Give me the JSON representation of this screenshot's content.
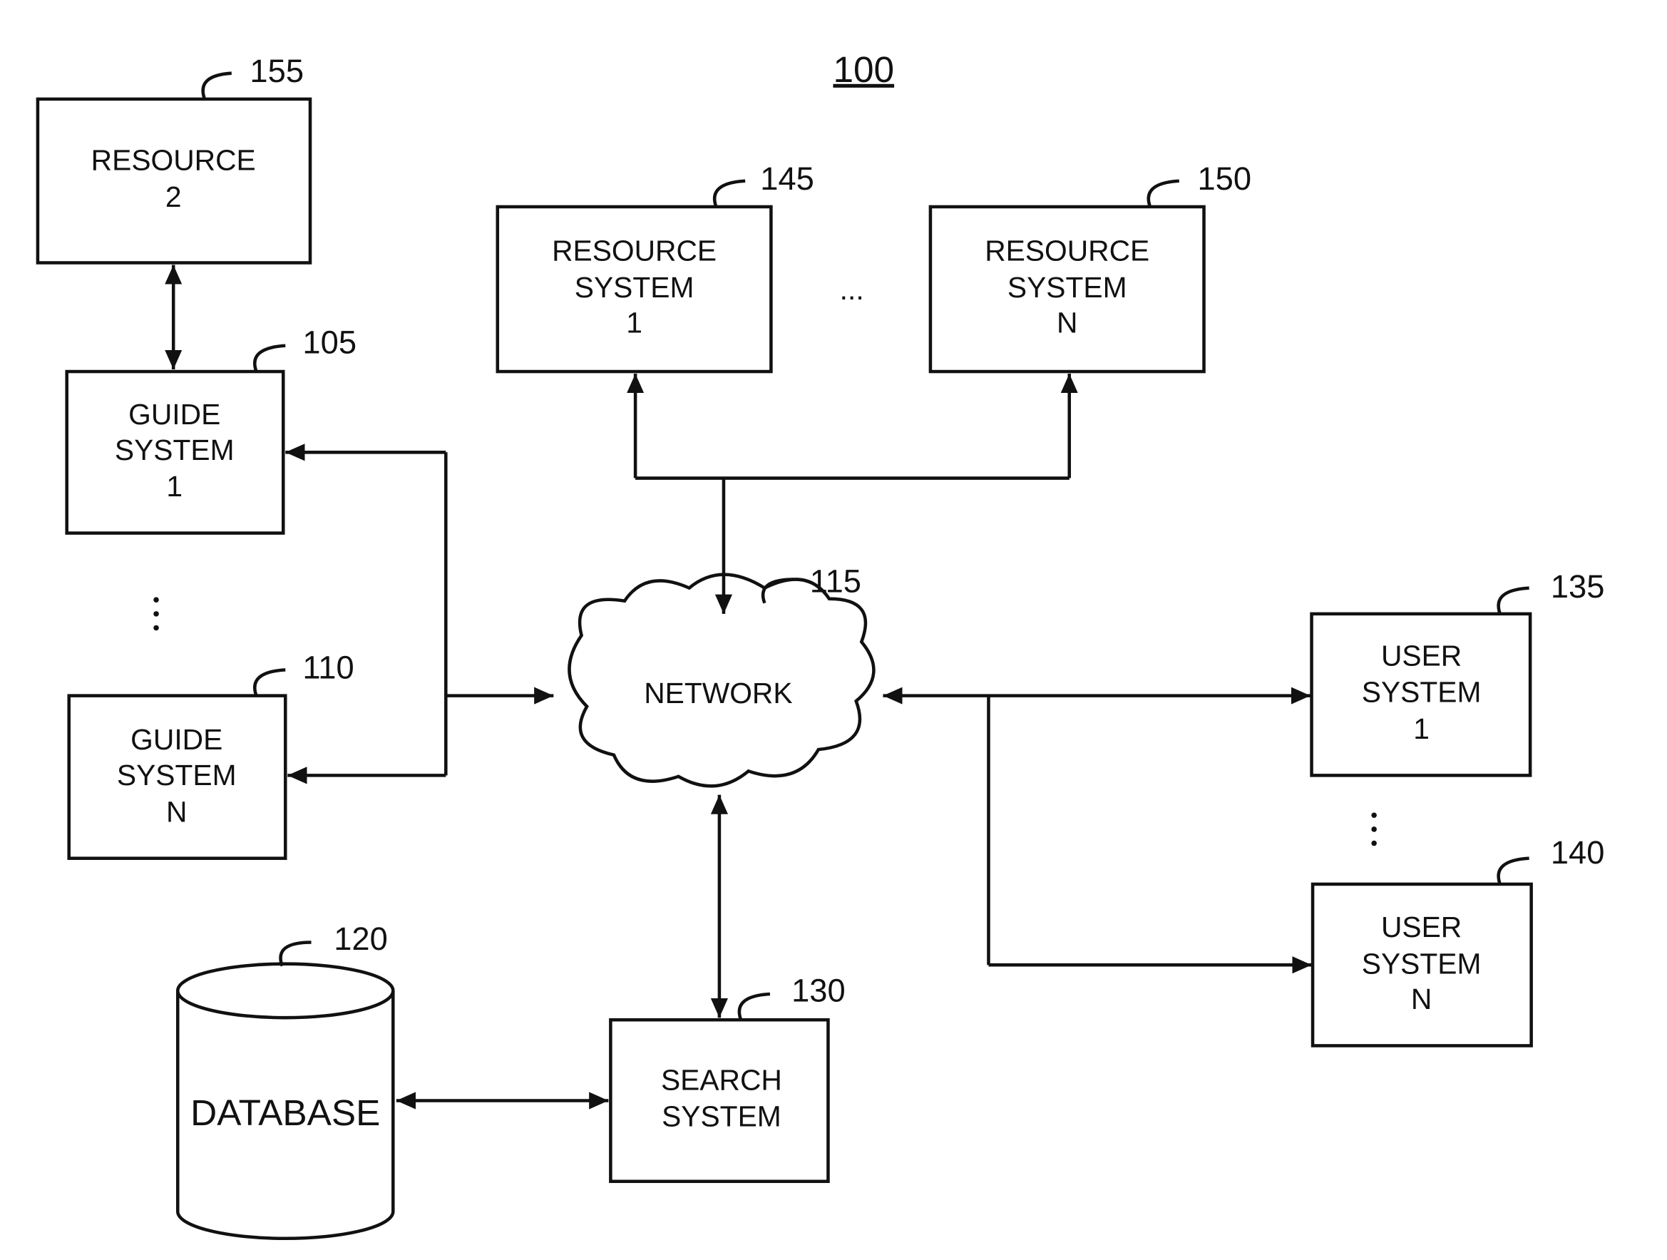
{
  "figure_number": "100",
  "nodes": {
    "resource2": {
      "ref": "155",
      "lines": [
        "RESOURCE",
        "2"
      ]
    },
    "guide1": {
      "ref": "105",
      "lines": [
        "GUIDE",
        "SYSTEM",
        "1"
      ]
    },
    "guideN": {
      "ref": "110",
      "lines": [
        "GUIDE",
        "SYSTEM",
        "N"
      ]
    },
    "resourceSys1": {
      "ref": "145",
      "lines": [
        "RESOURCE",
        "SYSTEM",
        "1"
      ]
    },
    "resourceSysN": {
      "ref": "150",
      "lines": [
        "RESOURCE",
        "SYSTEM",
        "N"
      ]
    },
    "network": {
      "ref": "115",
      "lines": [
        "NETWORK"
      ]
    },
    "user1": {
      "ref": "135",
      "lines": [
        "USER",
        "SYSTEM",
        "1"
      ]
    },
    "userN": {
      "ref": "140",
      "lines": [
        "USER",
        "SYSTEM",
        "N"
      ]
    },
    "database": {
      "ref": "120",
      "lines": [
        "DATABASE"
      ]
    },
    "search": {
      "ref": "130",
      "lines": [
        "SEARCH",
        "SYSTEM"
      ]
    }
  },
  "ellipsis": "..."
}
